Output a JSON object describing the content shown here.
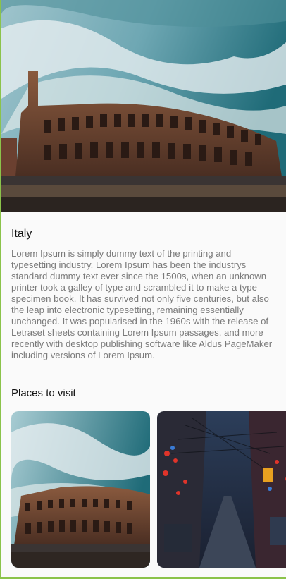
{
  "hero": {
    "image": "colosseum-photo"
  },
  "destination": {
    "title": "Italy",
    "description": "Lorem Ipsum is simply dummy text of the printing and typesetting industry. Lorem Ipsum has been the industrys standard dummy text ever since the 1500s, when an unknown printer took a galley of type and scrambled it to make a type specimen book. It has survived not only five centuries, but also the leap into electronic typesetting, remaining essentially unchanged. It was popularised in the 1960s with the release of Letraset sheets containing Lorem Ipsum passages, and more recently with desktop publishing software like Aldus PageMaker including versions of Lorem Ipsum."
  },
  "places": {
    "heading": "Places to visit",
    "items": [
      {
        "image": "colosseum-photo"
      },
      {
        "image": "night-street-photo"
      }
    ]
  },
  "colors": {
    "accent_frame": "#8bc34a",
    "text_primary": "#111111",
    "text_secondary": "#7a7a7a",
    "background": "#fafafa"
  }
}
